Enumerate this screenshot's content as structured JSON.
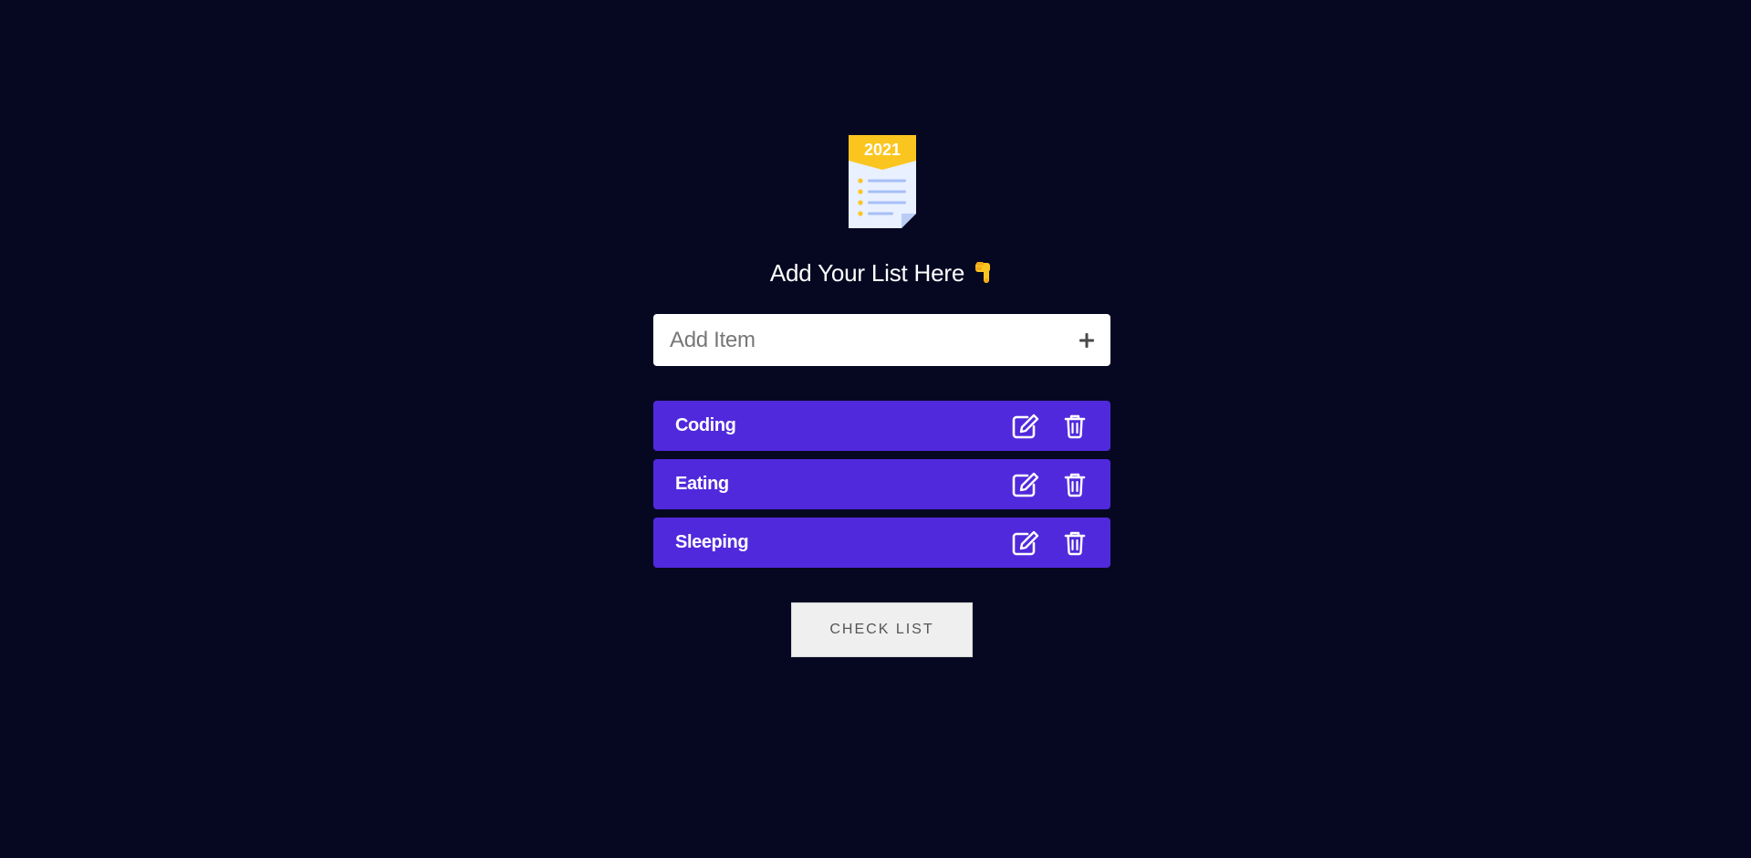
{
  "logo": {
    "year": "2021",
    "icon": "checklist-icon",
    "colors": {
      "ribbon": "#fbc51f",
      "paper": "#e9f0ff",
      "lines": "#a6bff6"
    }
  },
  "heading": {
    "text": "Add Your List Here",
    "emoji_icon": "pointing-down-hand-icon"
  },
  "add_item": {
    "placeholder": "Add Item",
    "value": "",
    "add_icon": "plus-icon"
  },
  "items": [
    {
      "label": "Coding",
      "edit_icon": "edit-icon",
      "delete_icon": "trash-icon"
    },
    {
      "label": "Eating",
      "edit_icon": "edit-icon",
      "delete_icon": "trash-icon"
    },
    {
      "label": "Sleeping",
      "edit_icon": "edit-icon",
      "delete_icon": "trash-icon"
    }
  ],
  "check_button": {
    "label": "CHECK LIST"
  },
  "colors": {
    "background": "#060822",
    "item_background": "#5129dc",
    "input_background": "#ffffff",
    "button_background": "#efefef"
  }
}
